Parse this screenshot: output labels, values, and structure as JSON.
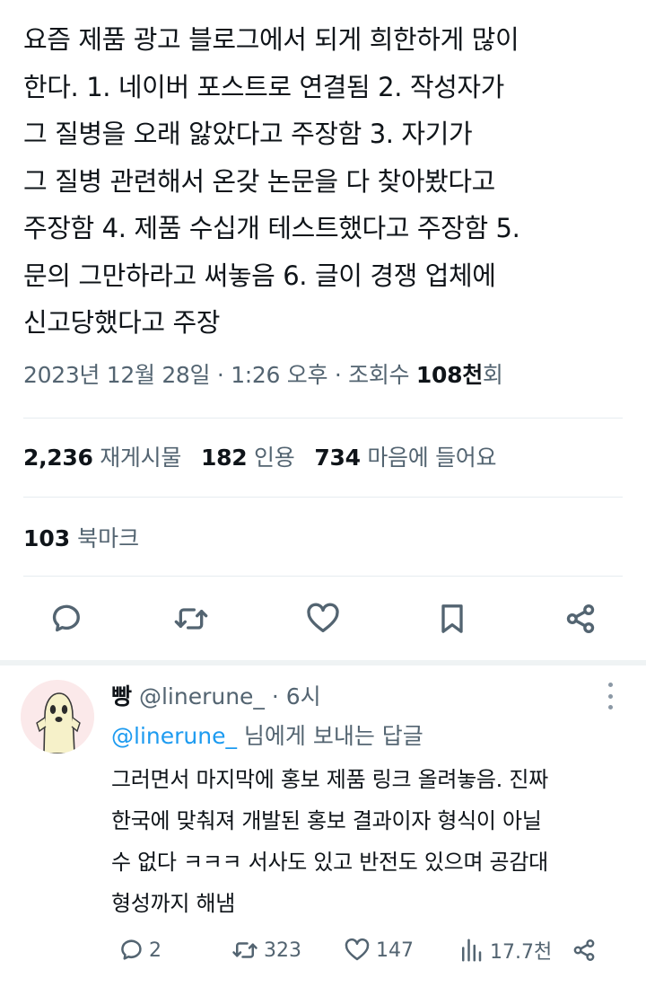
{
  "tweet": {
    "lines": [
      "요즘 제품 광고 블로그에서 되게 희한하게 많이",
      "한다. 1. 네이버 포스트로 연결됨 2. 작성자가",
      "그 질병을 오래 앓았다고 주장함 3. 자기가",
      "그 질병 관련해서 온갖 논문을 다 찾아봤다고",
      "주장함 4. 제품 수십개 테스트했다고 주장함 5.",
      "문의 그만하라고 써놓음 6. 글이 경쟁 업체에",
      "신고당했다고 주장"
    ],
    "date": "2023년 12월 28일",
    "sep1": " · ",
    "time": "1:26 오후",
    "sep2": " · ",
    "views_label": "조회수 ",
    "views_count": "108천",
    "views_unit": "회"
  },
  "stats": {
    "reposts_count": "2,236",
    "reposts_label": "재게시물",
    "quotes_count": "182",
    "quotes_label": "인용",
    "likes_count": "734",
    "likes_label": "마음에 들어요",
    "bookmarks_count": "103",
    "bookmarks_label": "북마크"
  },
  "actions": {
    "icons": [
      "reply-icon",
      "repost-icon",
      "like-icon",
      "bookmark-icon",
      "share-icon"
    ]
  },
  "reply": {
    "name": "빵",
    "handle": "@linerune_",
    "sep": " · ",
    "time": "6시",
    "replying_mention": "@linerune_",
    "replying_rest": " 님에게 보내는 답글",
    "lines": [
      "그러면서 마지막에 홍보 제품 링크 올려놓음. 진짜",
      "한국에 맞춰져 개발된 홍보 결과이자 형식이 아닐",
      "수 없다 ㅋㅋㅋ 서사도 있고 반전도 있으며 공감대",
      "형성까지 해냄"
    ],
    "replies_count": "2",
    "reposts_count": "323",
    "likes_count": "147",
    "views_count": "17.7천"
  },
  "colors": {
    "text": "#0f1419",
    "secondary": "#536471",
    "accent": "#1d9bf0",
    "divider": "#e6ecf0"
  }
}
